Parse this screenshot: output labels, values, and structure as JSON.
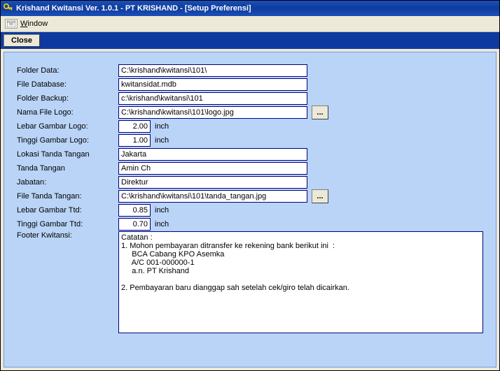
{
  "title": "Krishand Kwitansi Ver. 1.0.1 - PT KRISHAND - [Setup Preferensi]",
  "menu": {
    "window_label": "Window"
  },
  "toolbar": {
    "close_label": "Close"
  },
  "form": {
    "folder_data": {
      "label": "Folder Data:",
      "value": "C:\\krishand\\kwitansi\\101\\"
    },
    "file_database": {
      "label": "File Database:",
      "value": "kwitansidat.mdb"
    },
    "folder_backup": {
      "label": "Folder Backup:",
      "value": "c:\\krishand\\kwitansi\\101"
    },
    "nama_file_logo": {
      "label": "Nama File Logo:",
      "value": "C:\\krishand\\kwitansi\\101\\logo.jpg",
      "browse": "..."
    },
    "lebar_gambar_logo": {
      "label": "Lebar Gambar Logo:",
      "value": "2.00",
      "unit": "inch"
    },
    "tinggi_gambar_logo": {
      "label": "Tinggi Gambar Logo:",
      "value": "1.00",
      "unit": "inch"
    },
    "lokasi_tanda_tangan": {
      "label": "Lokasi Tanda Tangan",
      "value": "Jakarta"
    },
    "tanda_tangan": {
      "label": "Tanda Tangan",
      "value": "Amin Ch"
    },
    "jabatan": {
      "label": "Jabatan:",
      "value": "Direktur"
    },
    "file_tanda_tangan": {
      "label": "File Tanda Tangan:",
      "value": "C:\\krishand\\kwitansi\\101\\tanda_tangan.jpg",
      "browse": "..."
    },
    "lebar_gambar_ttd": {
      "label": "Lebar Gambar Ttd:",
      "value": "0.85",
      "unit": "inch"
    },
    "tinggi_gambar_ttd": {
      "label": "Tinggi Gambar Ttd:",
      "value": "0.70",
      "unit": "inch"
    },
    "footer_kwitansi": {
      "label": "Footer Kwitansi:",
      "value": "Catatan :\n1. Mohon pembayaran ditransfer ke rekening bank berikut ini  :\n     BCA Cabang KPO Asemka\n     A/C 001-000000-1\n     a.n. PT Krishand\n\n2. Pembayaran baru dianggap sah setelah cek/giro telah dicairkan."
    }
  }
}
